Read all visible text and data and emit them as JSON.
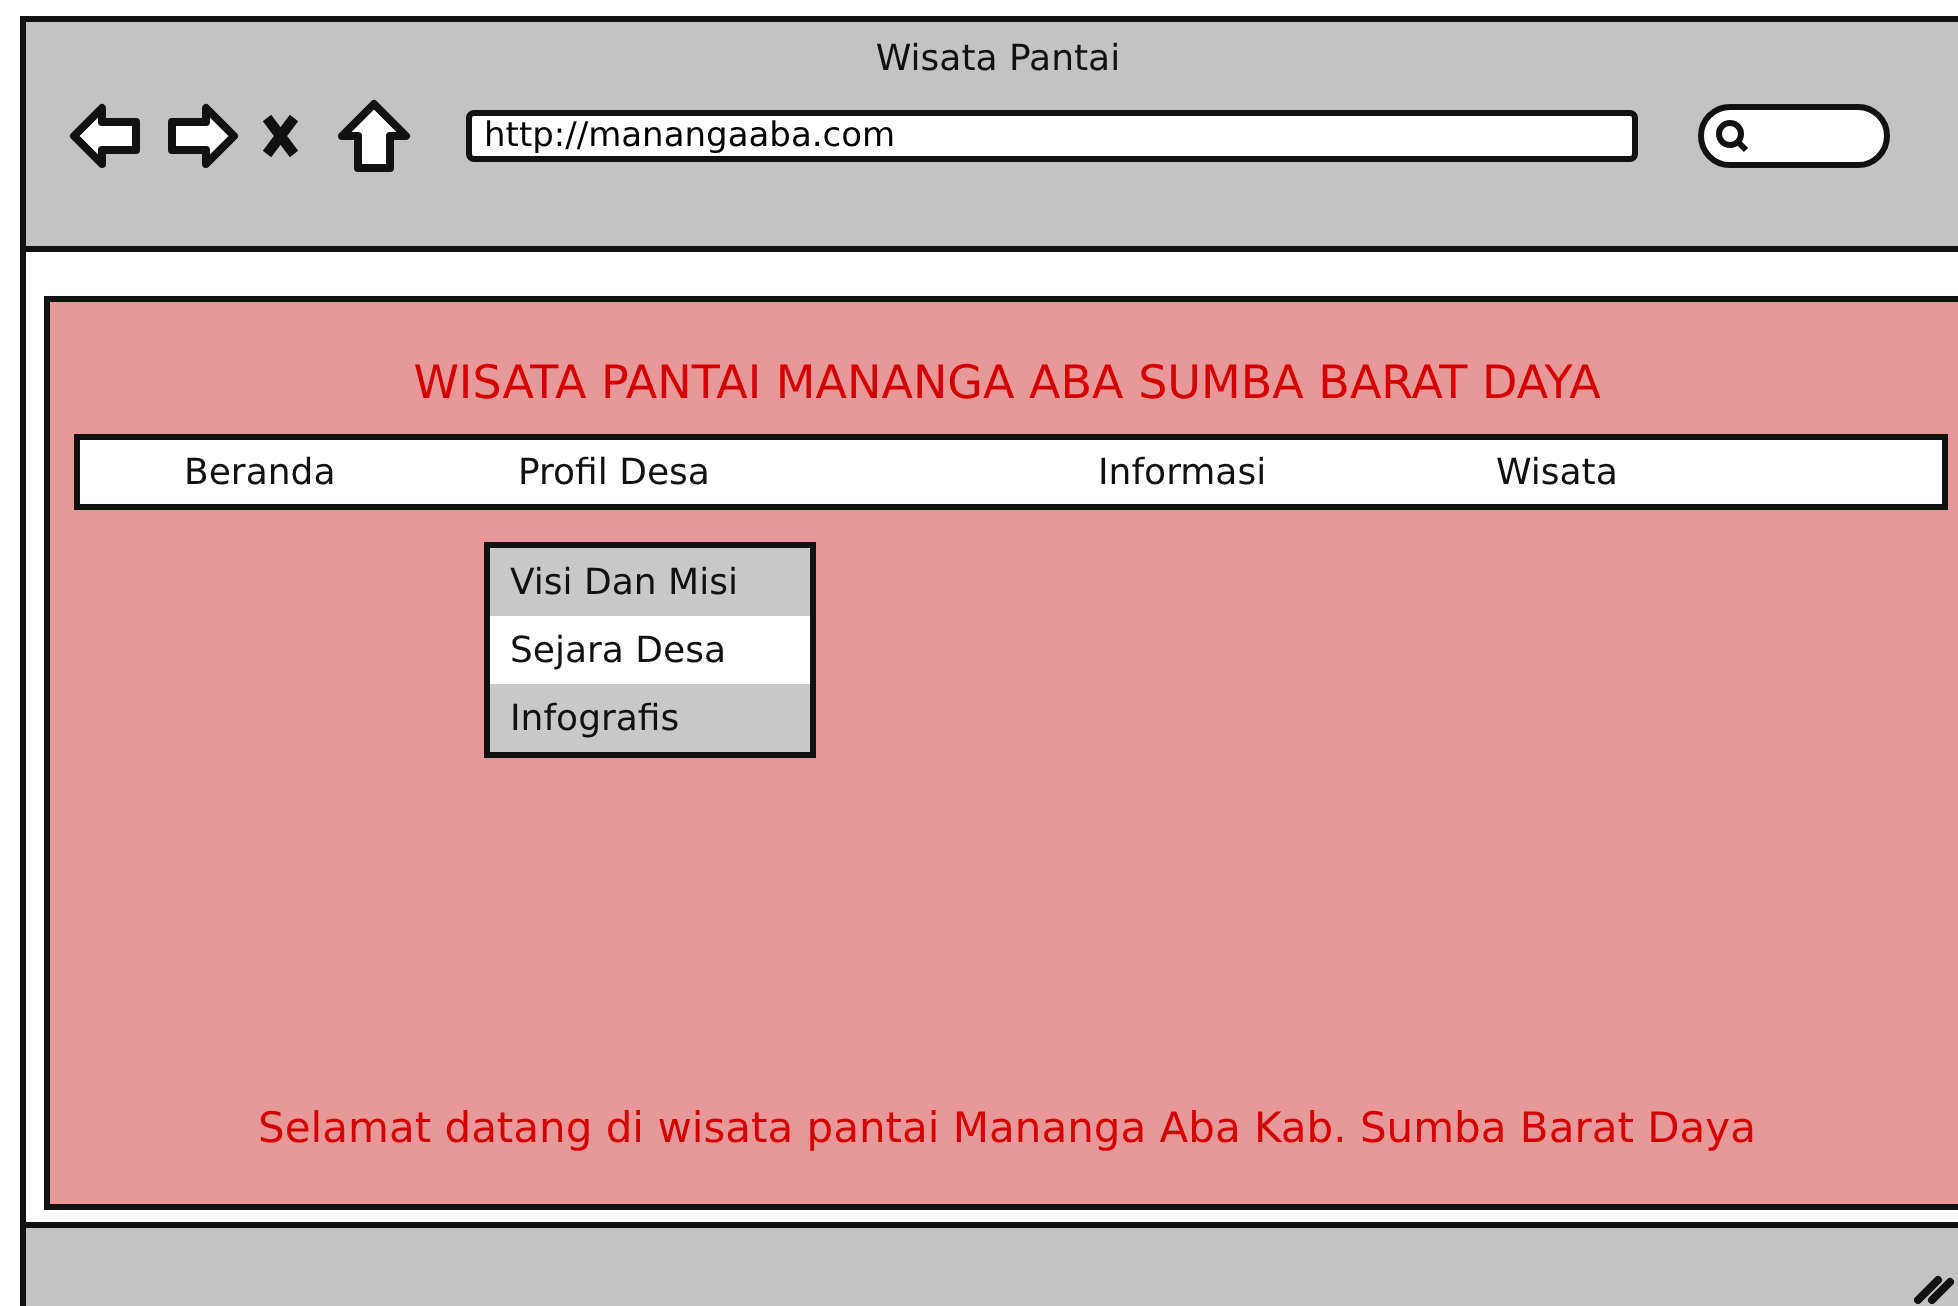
{
  "window": {
    "title": "Wisata Pantai"
  },
  "address_bar": {
    "value": "http://manangaaba.com"
  },
  "page": {
    "heading": "WISATA PANTAI MANANGA ABA SUMBA BARAT DAYA",
    "nav": [
      {
        "label": "Beranda"
      },
      {
        "label": "Profil Desa"
      },
      {
        "label": "Informasi"
      },
      {
        "label": "Wisata"
      }
    ],
    "dropdown": [
      {
        "label": "Visi Dan Misi",
        "selected": false
      },
      {
        "label": "Sejara Desa",
        "selected": true
      },
      {
        "label": "Infografis",
        "selected": false
      }
    ],
    "welcome": "Selamat datang di wisata pantai Mananga Aba Kab. Sumba Barat Daya"
  }
}
